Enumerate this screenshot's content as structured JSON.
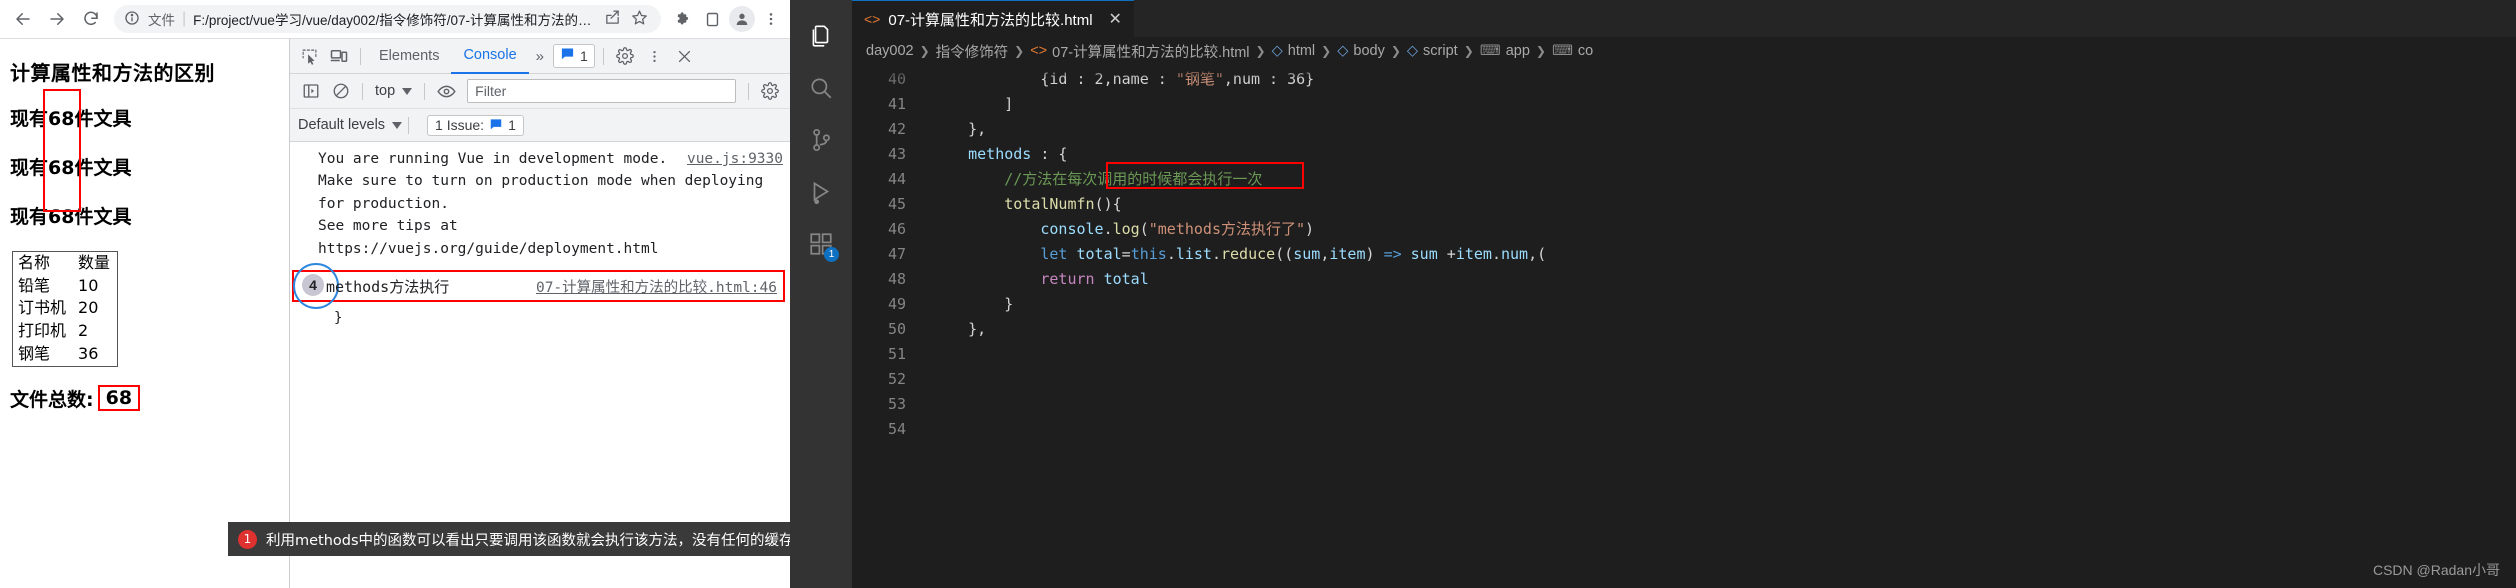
{
  "browser": {
    "back_icon": "back-arrow-icon",
    "forward_icon": "forward-arrow-icon",
    "reload_icon": "reload-icon",
    "info_icon": "info-circle-icon",
    "scheme_label": "文件",
    "url": "F:/project/vue学习/vue/day002/指令修饰符/07-计算属性和方法的比...",
    "share_icon": "share-icon",
    "bookmark_icon": "star-icon",
    "extensions_icon": "puzzle-icon",
    "sidepanel_icon": "side-panel-icon",
    "profile_icon": "profile-avatar-icon",
    "menu_icon": "three-dots-menu-icon"
  },
  "page": {
    "heading": "计算属性和方法的区别",
    "lines": [
      "现有68件文具",
      "现有68件文具",
      "现有68件文具"
    ],
    "table": {
      "headers": [
        "名称",
        "数量"
      ],
      "rows": [
        [
          "铅笔",
          "10"
        ],
        [
          "订书机",
          "20"
        ],
        [
          "打印机",
          "2"
        ],
        [
          "钢笔",
          "36"
        ]
      ]
    },
    "total_label": "文件总数:",
    "total_value": "68",
    "highlight_color": "#ff0000"
  },
  "devtools": {
    "inspect_icon": "inspect-element-icon",
    "device_icon": "device-toolbar-icon",
    "tabs": [
      {
        "label": "Elements",
        "active": false
      },
      {
        "label": "Console",
        "active": true
      }
    ],
    "more_tabs_icon": "chevron-double-right-icon",
    "issues_icon": "issues-message-icon",
    "issues_count": "1",
    "settings_icon": "gear-icon",
    "kebab_icon": "three-dots-vertical-icon",
    "close_icon": "close-x-icon",
    "sidebar_toggle_icon": "console-sidebar-icon",
    "clear_icon": "clear-console-icon",
    "context": "top",
    "eye_icon": "live-expression-eye-icon",
    "filter_placeholder": "Filter",
    "console_settings_icon": "console-settings-gear-icon",
    "levels_label": "Default levels",
    "issue_chip_label": "1 Issue:",
    "issue_chip_count": "1",
    "messages": [
      {
        "text": "You are running Vue in development mode.\nMake sure to turn on production mode when deploying for production.\nSee more tips at ",
        "link": "https://vuejs.org/guide/deployment.html",
        "source": "vue.js:9330"
      }
    ],
    "exec_badge": "4",
    "exec_text": "methods方法执行",
    "exec_source": "07-计算属性和方法的比较.html:46",
    "tail": "}"
  },
  "annotation": {
    "number": "1",
    "text": "利用methods中的函数可以看出只要调用该函数就会执行该方法，没有任何的缓存特性",
    "badge_color": "#e03131",
    "bar_color": "#3a3a3a"
  },
  "vscode": {
    "activity_icons": [
      {
        "name": "explorer-files-icon",
        "active": true,
        "badge": ""
      },
      {
        "name": "search-icon",
        "active": false,
        "badge": ""
      },
      {
        "name": "source-control-icon",
        "active": false,
        "badge": ""
      },
      {
        "name": "run-debug-icon",
        "active": false,
        "badge": ""
      },
      {
        "name": "extensions-icon",
        "active": false,
        "badge": "1"
      }
    ],
    "tab": {
      "label": "07-计算属性和方法的比较.html",
      "icon": "html-file-icon",
      "close_icon": "close-x-icon"
    },
    "breadcrumb": [
      {
        "label": "day002",
        "icon": ""
      },
      {
        "label": "指令修饰符",
        "icon": ""
      },
      {
        "label": "07-计算属性和方法的比较.html",
        "icon": "html-file-icon"
      },
      {
        "label": "html",
        "icon": "tag-icon"
      },
      {
        "label": "body",
        "icon": "tag-icon"
      },
      {
        "label": "script",
        "icon": "tag-icon"
      },
      {
        "label": "app",
        "icon": "at-icon"
      },
      {
        "label": "co",
        "icon": "at-icon"
      }
    ],
    "line_numbers": [
      "40",
      "41",
      "42",
      "43",
      "44",
      "45",
      "46",
      "47",
      "48",
      "49",
      "50",
      "51",
      "52",
      "53",
      "54"
    ],
    "code_lines": [
      {
        "num": "40",
        "segments": [
          {
            "t": "            ",
            "c": "k-pl"
          },
          {
            "t": "{id : 2,name : ",
            "c": "k-pl"
          },
          {
            "t": "\"钢笔\"",
            "c": "k-str"
          },
          {
            "t": ",num : 36}",
            "c": "k-pl"
          }
        ]
      },
      {
        "num": "41",
        "segments": [
          {
            "t": "        ]",
            "c": "k-pl"
          }
        ]
      },
      {
        "num": "42",
        "segments": [
          {
            "t": "    },",
            "c": "k-pl"
          }
        ]
      },
      {
        "num": "43",
        "segments": [
          {
            "t": "    ",
            "c": "k-pl"
          },
          {
            "t": "methods",
            "c": "k-var"
          },
          {
            "t": " : {",
            "c": "k-pl"
          }
        ]
      },
      {
        "num": "44",
        "segments": [
          {
            "t": "        ",
            "c": "k-pl"
          },
          {
            "t": "//方法在每次调用的时候都会执行一次",
            "c": "k-cmt"
          }
        ]
      },
      {
        "num": "45",
        "segments": [
          {
            "t": "        ",
            "c": "k-pl"
          },
          {
            "t": "totalNumfn",
            "c": "k-fn"
          },
          {
            "t": "(){",
            "c": "k-pl"
          }
        ]
      },
      {
        "num": "46",
        "segments": [
          {
            "t": "            ",
            "c": "k-pl"
          },
          {
            "t": "console",
            "c": "k-var"
          },
          {
            "t": ".",
            "c": "k-pl"
          },
          {
            "t": "log",
            "c": "k-fn"
          },
          {
            "t": "(",
            "c": "k-pl"
          },
          {
            "t": "\"methods方法执行了\"",
            "c": "k-str"
          },
          {
            "t": ")",
            "c": "k-pl"
          }
        ]
      },
      {
        "num": "47",
        "segments": [
          {
            "t": "            ",
            "c": "k-pl"
          },
          {
            "t": "let",
            "c": "k-kw"
          },
          {
            "t": " ",
            "c": "k-pl"
          },
          {
            "t": "total",
            "c": "k-var"
          },
          {
            "t": "=",
            "c": "k-pl"
          },
          {
            "t": "this",
            "c": "k-kw"
          },
          {
            "t": ".",
            "c": "k-pl"
          },
          {
            "t": "list",
            "c": "k-var"
          },
          {
            "t": ".",
            "c": "k-pl"
          },
          {
            "t": "reduce",
            "c": "k-fn"
          },
          {
            "t": "((",
            "c": "k-pl"
          },
          {
            "t": "sum",
            "c": "k-var"
          },
          {
            "t": ",",
            "c": "k-pl"
          },
          {
            "t": "item",
            "c": "k-var"
          },
          {
            "t": ") ",
            "c": "k-pl"
          },
          {
            "t": "=>",
            "c": "k-kw"
          },
          {
            "t": " ",
            "c": "k-pl"
          },
          {
            "t": "sum",
            "c": "k-var"
          },
          {
            "t": " +",
            "c": "k-pl"
          },
          {
            "t": "item",
            "c": "k-var"
          },
          {
            "t": ".",
            "c": "k-pl"
          },
          {
            "t": "num",
            "c": "k-var"
          },
          {
            "t": ",(",
            "c": "k-pl"
          }
        ]
      },
      {
        "num": "48",
        "segments": [
          {
            "t": "            ",
            "c": "k-pl"
          },
          {
            "t": "return",
            "c": "k-kw2"
          },
          {
            "t": " ",
            "c": "k-pl"
          },
          {
            "t": "total",
            "c": "k-var"
          }
        ]
      },
      {
        "num": "49",
        "segments": [
          {
            "t": "        }",
            "c": "k-pl"
          }
        ]
      },
      {
        "num": "50",
        "segments": [
          {
            "t": "    },",
            "c": "k-pl"
          }
        ]
      },
      {
        "num": "51",
        "segments": [
          {
            "t": "",
            "c": "k-pl"
          }
        ]
      },
      {
        "num": "52",
        "segments": [
          {
            "t": "",
            "c": "k-pl"
          }
        ]
      },
      {
        "num": "53",
        "segments": [
          {
            "t": "",
            "c": "k-pl"
          }
        ]
      },
      {
        "num": "54",
        "segments": [
          {
            "t": "",
            "c": "k-pl"
          }
        ]
      }
    ],
    "highlight_line": "45",
    "watermark": "CSDN @Radan小哥"
  }
}
